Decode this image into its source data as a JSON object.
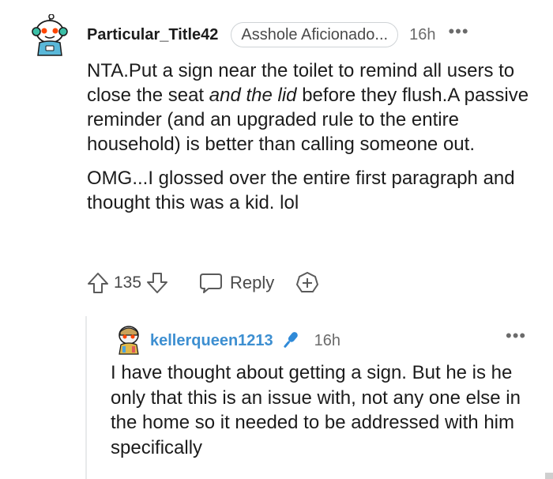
{
  "top_comment": {
    "username": "Particular_Title42",
    "flair": "Asshole Aficionado...",
    "timestamp": "16h",
    "more": "•••",
    "body": {
      "p1_a": "NTA.Put a sign near the toilet to remind all users to close the seat ",
      "p1_em": "and the lid",
      "p1_b": " before they flush.A passive reminder (and an upgraded rule to the entire household) is better than calling someone out.",
      "p2": "OMG...I glossed over the entire first paragraph and thought this was a kid. lol"
    },
    "actions": {
      "vote_count": "135",
      "reply_label": "Reply"
    }
  },
  "reply_comment": {
    "username": "kellerqueen1213",
    "timestamp": "16h",
    "more": "•••",
    "body": "I have thought about getting a sign. But he is he only that this is an issue with, not any one else in the home so it needed to be addressed with him specifically"
  },
  "colors": {
    "text": "#1c1c1c",
    "meta": "#6b6b6b",
    "op_blue": "#3d8fd1",
    "flair_border": "#cfd3d6"
  },
  "icons": [
    "snoo-avatar-icon",
    "upvote-icon",
    "downvote-icon",
    "reply-bubble-icon",
    "add-award-icon",
    "microphone-icon",
    "more-options-icon"
  ]
}
